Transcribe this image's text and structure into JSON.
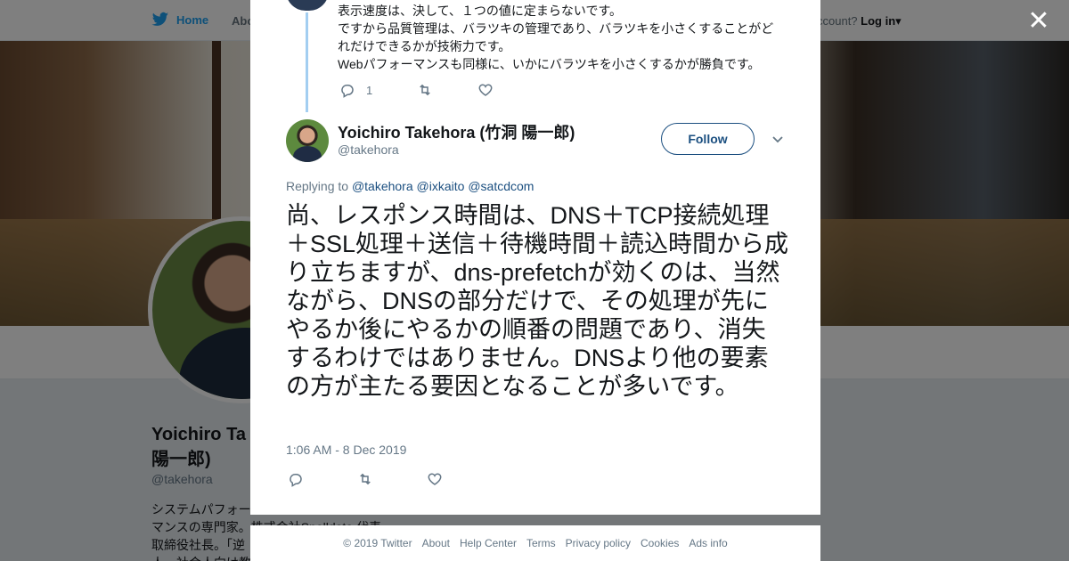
{
  "background": {
    "nav": {
      "home": "Home",
      "about": "Abo",
      "account_prompt": "ccount?",
      "login": "Log in"
    },
    "profile": {
      "name": "Yoichiro Ta\n陽一郎)",
      "handle": "@takehora",
      "bio": "システムパフォー\nマンスの専門家。株式会社Spelldata 代表\n取締役社長。「逆\n人、社会人向け教"
    }
  },
  "close_icon": "close-icon",
  "previous_tweet": {
    "text": "表示速度は、決して、１つの値に定まらないです。\nですから品質管理は、バラツキの管理であり、バラツキを小さくすることがどれだけできるかが技術力です。\nWebパフォーマンスも同様に、いかにバラツキを小さくするかが勝負です。",
    "reply_count": "1"
  },
  "tweet": {
    "author_name": "Yoichiro Takehora (竹洞 陽一郎)",
    "author_handle": "@takehora",
    "follow_label": "Follow",
    "replying_prefix": "Replying to",
    "replying_to": [
      "@takehora",
      "@ixkaito",
      "@satcdcom"
    ],
    "text": "尚、レスポンス時間は、DNS＋TCP接続処理＋SSL処理＋送信＋待機時間＋読込時間から成り立ちますが、dns-prefetchが効くのは、当然ながら、DNSの部分だけで、その処理が先にやるか後にやるかの順番の問題であり、消失するわけではありません。DNSより他の要素の方が主たる要因となることが多いです。",
    "timestamp": "1:06 AM - 8 Dec 2019"
  },
  "footer": {
    "copyright": "© 2019 Twitter",
    "links": [
      "About",
      "Help Center",
      "Terms",
      "Privacy policy",
      "Cookies",
      "Ads info"
    ]
  },
  "colors": {
    "twitter_blue": "#1da1f2",
    "link": "#1b4f80",
    "thread_line": "#a3cef1",
    "muted": "#657786"
  }
}
